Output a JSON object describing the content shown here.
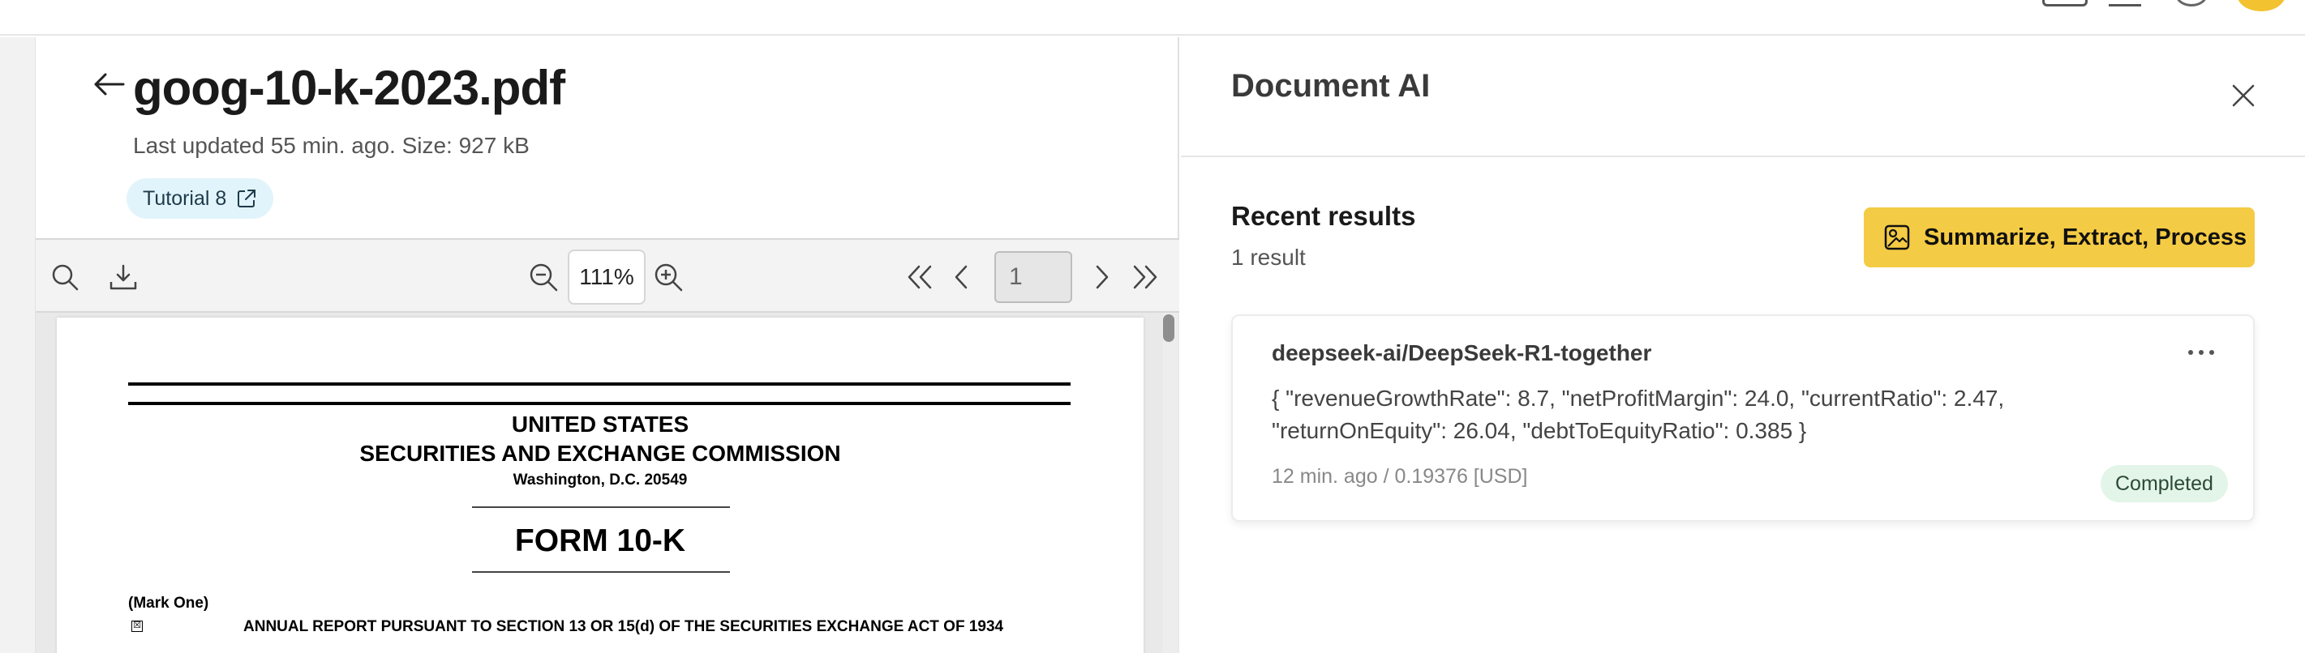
{
  "left": {
    "title": "goog-10-k-2023.pdf",
    "meta": "Last updated 55 min. ago. Size: 927 kB",
    "tag": "Tutorial 8",
    "toolbar": {
      "zoom": "111%",
      "page": "1"
    }
  },
  "document_page": {
    "line1": "UNITED STATES",
    "line2": "SECURITIES AND EXCHANGE COMMISSION",
    "line3": "Washington, D.C. 20549",
    "form": "FORM 10-K",
    "mark_one": "(Mark One)",
    "checkbox": "☒",
    "annual_report": "ANNUAL REPORT PURSUANT TO SECTION 13 OR 15(d) OF THE SECURITIES EXCHANGE ACT OF 1934"
  },
  "right": {
    "title": "Document AI",
    "recent_title": "Recent results",
    "recent_count": "1 result",
    "primary_button": "Summarize, Extract, Process",
    "result": {
      "model": "deepseek-ai/DeepSeek-R1-together",
      "text": "{ \"revenueGrowthRate\": 8.7, \"netProfitMargin\": 24.0, \"currentRatio\": 2.47, \"returnOnEquity\": 26.04, \"debtToEquityRatio\": 0.385 }",
      "meta": "12 min. ago / 0.19376 [USD]",
      "status": "Completed"
    }
  },
  "colors": {
    "accent": "#f4cb44",
    "tag_bg": "#e1f4fb",
    "status_bg": "#e3f5e8"
  }
}
